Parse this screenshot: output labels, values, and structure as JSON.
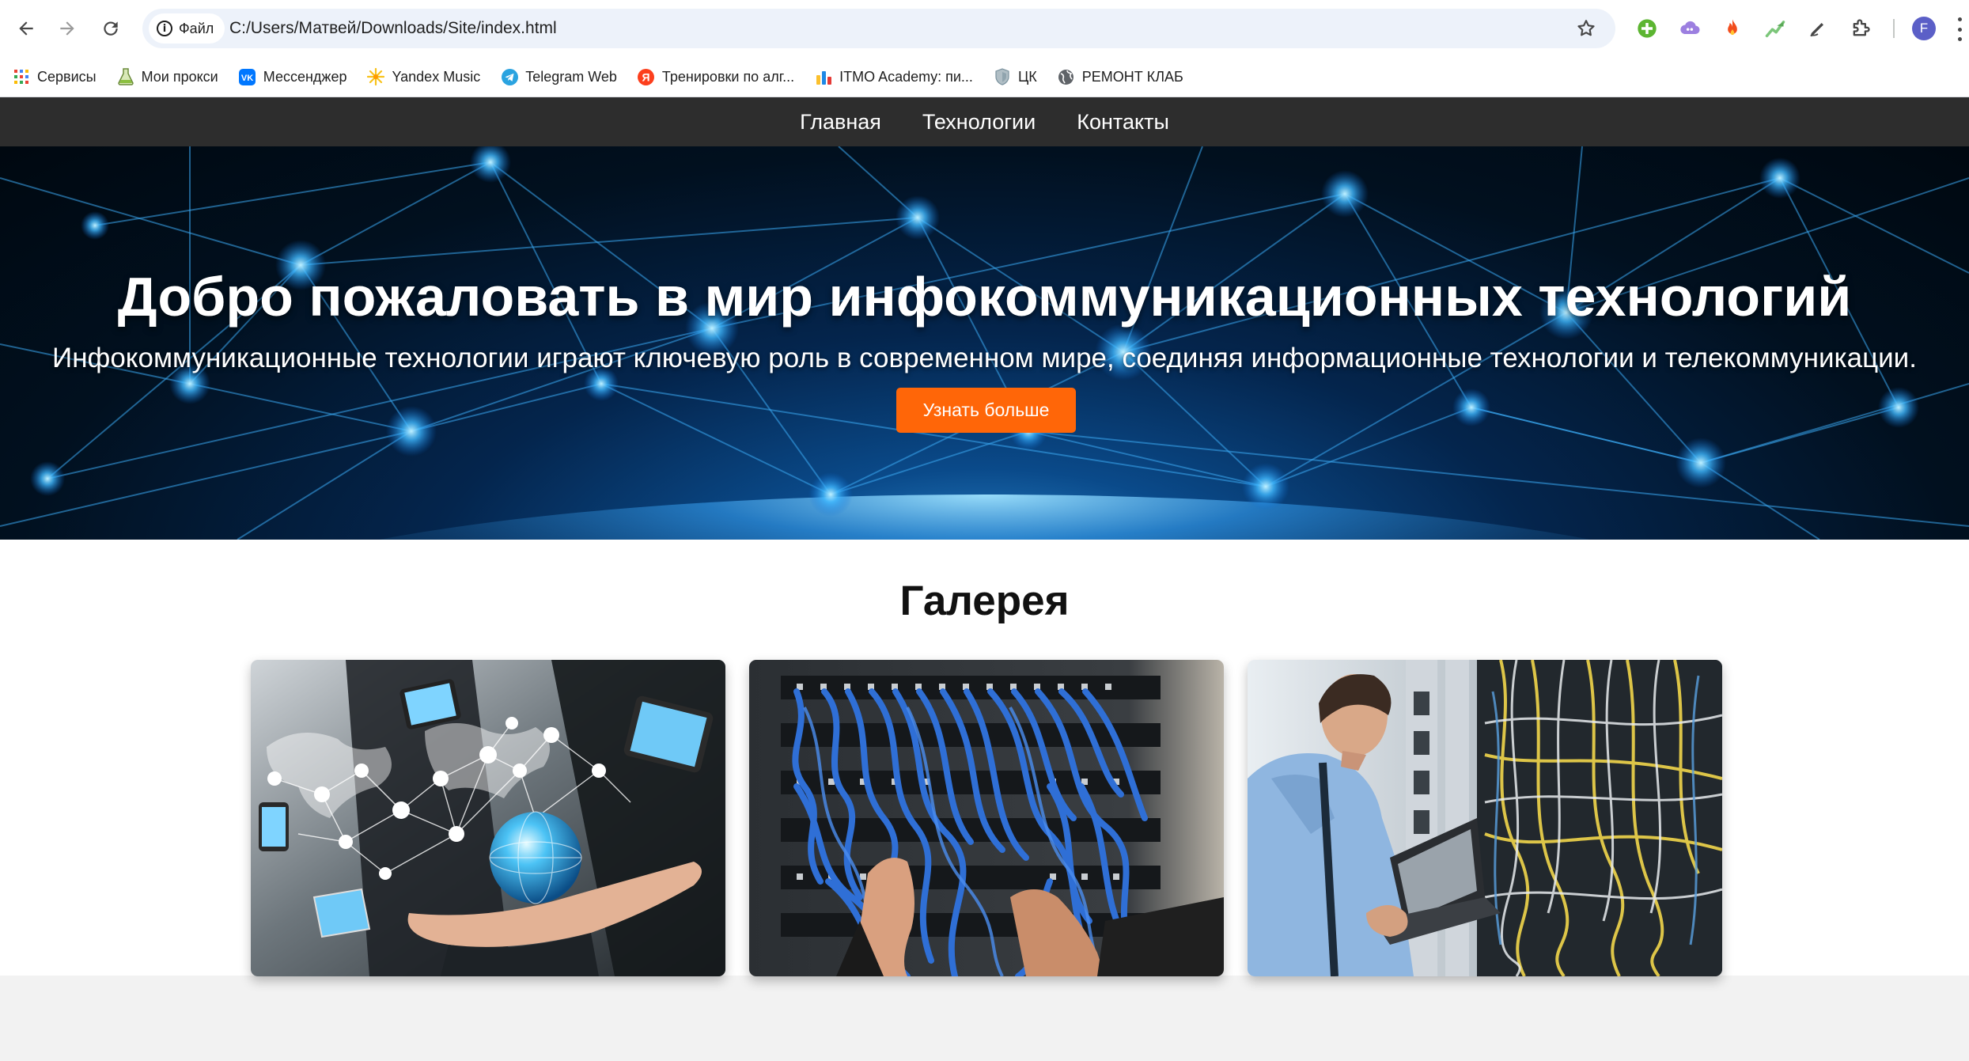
{
  "browser": {
    "site_chip_label": "Файл",
    "url": "C:/Users/Матвей/Downloads/Site/index.html",
    "profile_initial": "F",
    "bookmarks": [
      {
        "label": "Сервисы",
        "icon": "apps-grid-icon"
      },
      {
        "label": "Мои прокси",
        "icon": "flask-icon"
      },
      {
        "label": "Мессенджер",
        "icon": "vk-icon"
      },
      {
        "label": "Yandex Music",
        "icon": "yandex-music-icon"
      },
      {
        "label": "Telegram Web",
        "icon": "telegram-icon"
      },
      {
        "label": "Тренировки по алг...",
        "icon": "yandex-icon"
      },
      {
        "label": "ITMO Academy: пи...",
        "icon": "codeforces-icon"
      },
      {
        "label": "ЦК",
        "icon": "shield-icon"
      },
      {
        "label": "РЕМОНТ КЛАБ",
        "icon": "globe-icon"
      }
    ]
  },
  "site": {
    "nav": [
      "Главная",
      "Технологии",
      "Контакты"
    ],
    "hero": {
      "title": "Добро пожаловать в мир инфокоммуникационных технологий",
      "subtitle": "Инфокоммуникационные технологии играют ключевую роль в современном мире, соединяя информационные технологии и телекоммуникации.",
      "button": "Узнать больше"
    },
    "gallery": {
      "title": "Галерея",
      "images": [
        "network-hand-globe-image",
        "server-cables-image",
        "engineer-laptop-datacenter-image"
      ]
    }
  },
  "colors": {
    "nav_bg": "#2d2d2d",
    "accent_button": "#ff6608",
    "omnibox_bg": "#edf2fa"
  }
}
